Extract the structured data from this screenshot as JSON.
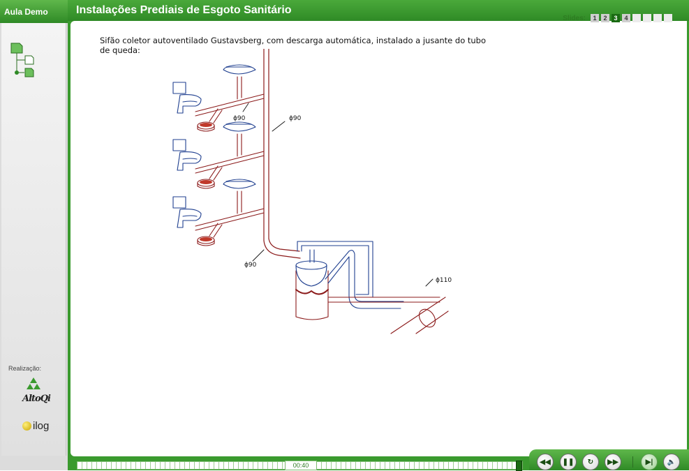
{
  "sidebar": {
    "title": "Aula Demo"
  },
  "header": {
    "title": "Instalações Prediais de Esgoto Sanitário"
  },
  "slides": {
    "label": "Slides:",
    "items": [
      "1",
      "2",
      "3",
      "4",
      "",
      "",
      "",
      ""
    ],
    "active_index": 2
  },
  "content": {
    "caption": "Sifão coletor autoventilado Gustavsberg, com descarga automática, instalado a jusante do tubo de queda:",
    "labels": {
      "d90_a": "ϕ90",
      "d90_b": "ϕ90",
      "d90_c": "ϕ90",
      "d110": "ϕ110"
    }
  },
  "credits": {
    "label": "Realização:",
    "logo1": "AltoQi",
    "logo2": "ilog"
  },
  "player": {
    "time": "00:40",
    "progress_fraction": 0.99,
    "buttons": [
      "rewind-icon",
      "pause-icon",
      "replay-icon",
      "fast-forward-icon",
      "skip-end-icon",
      "volume-icon"
    ]
  },
  "colors": {
    "accent": "#3a9a2e",
    "pipe_red": "#8b1a1a",
    "pipe_blue": "#1f3f8f"
  }
}
